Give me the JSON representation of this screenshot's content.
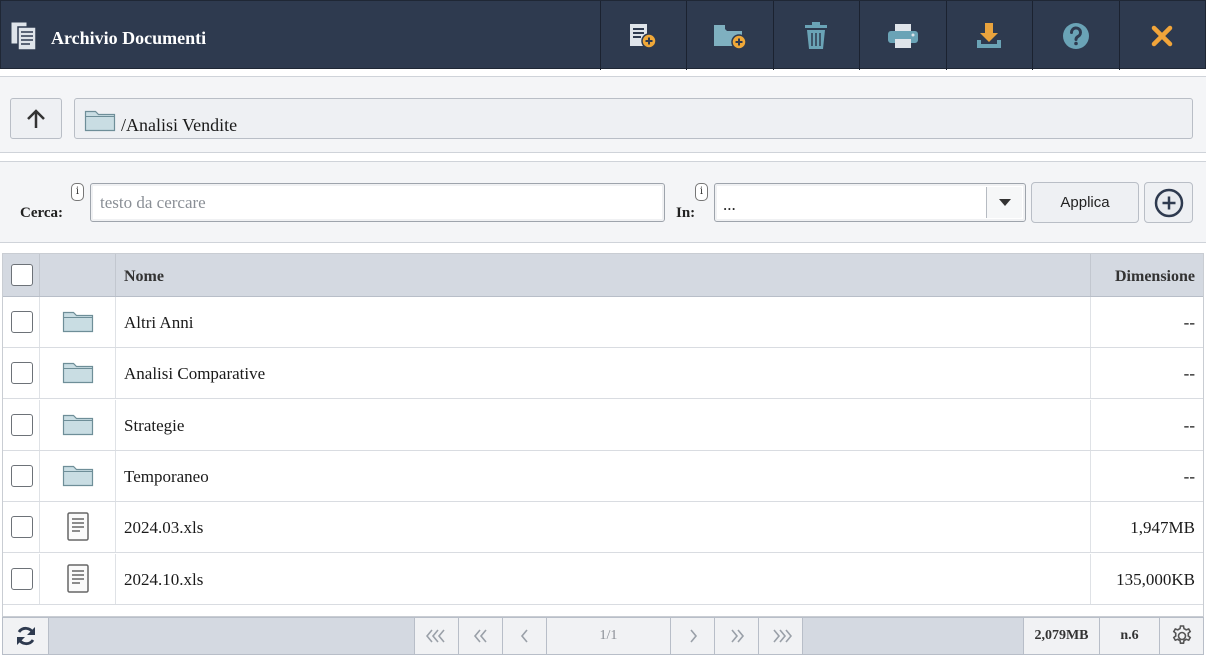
{
  "window": {
    "title": "Archivio Documenti",
    "icon": "document-copy-icon"
  },
  "toolbar": [
    {
      "name": "new-file-button",
      "icon": "new-file-icon",
      "color": "#dfe4ea"
    },
    {
      "name": "new-folder-button",
      "icon": "new-folder-icon",
      "color": "#7fb0c0"
    },
    {
      "name": "delete-button",
      "icon": "trash-icon",
      "color": "#6aa3b6"
    },
    {
      "name": "print-button",
      "icon": "printer-icon",
      "color": "#6aa3b6"
    },
    {
      "name": "download-button",
      "icon": "download-icon",
      "color": "#e9a33d"
    },
    {
      "name": "help-button",
      "icon": "help-icon",
      "color": "#6aa3b6"
    },
    {
      "name": "close-button",
      "icon": "close-icon",
      "color": "#f2a53a"
    }
  ],
  "path": {
    "up_icon": "arrow-up-icon",
    "folder_icon": "folder-icon",
    "current": "/Analisi Vendite"
  },
  "search": {
    "label": "Cerca:",
    "info": "i",
    "placeholder": "testo da cercare",
    "value": "",
    "in_label": "In:",
    "in_info": "i",
    "in_value": "...",
    "apply_label": "Applica",
    "add_icon": "plus-circle-icon"
  },
  "table": {
    "columns": {
      "name": "Nome",
      "size": "Dimensione"
    },
    "rows": [
      {
        "type": "folder",
        "name": "Altri Anni",
        "size": "--"
      },
      {
        "type": "folder",
        "name": "Analisi Comparative",
        "size": "--"
      },
      {
        "type": "folder",
        "name": "Strategie",
        "size": "--"
      },
      {
        "type": "folder",
        "name": "Temporaneo",
        "size": "--"
      },
      {
        "type": "file",
        "name": "2024.03.xls",
        "size": "1,947MB"
      },
      {
        "type": "file",
        "name": "2024.10.xls",
        "size": "135,000KB"
      }
    ]
  },
  "footer": {
    "refresh_icon": "refresh-icon",
    "first_icon": "first-page-icon",
    "prev_block_icon": "previous-block-icon",
    "prev_icon": "previous-page-icon",
    "page": "1/1",
    "next_icon": "next-page-icon",
    "next_block_icon": "next-block-icon",
    "last_icon": "last-page-icon",
    "total_size": "2,079MB",
    "count": "n.6",
    "settings_icon": "gear-icon"
  },
  "colors": {
    "header_bg": "#2e3a4f",
    "folder_fill": "#c9dde3",
    "folder_stroke": "#6e8e98"
  }
}
